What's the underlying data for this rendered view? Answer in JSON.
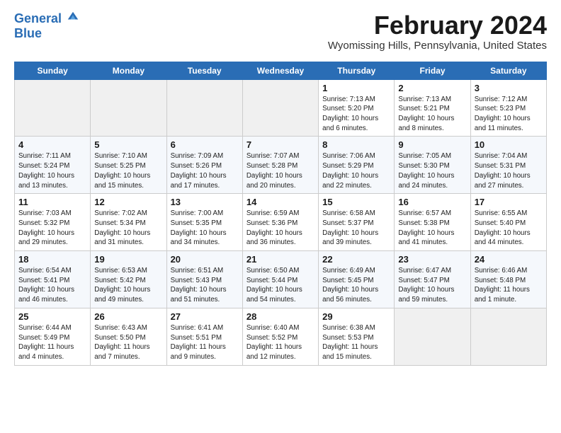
{
  "app": {
    "logo_line1": "General",
    "logo_line2": "Blue"
  },
  "header": {
    "month_year": "February 2024",
    "location": "Wyomissing Hills, Pennsylvania, United States"
  },
  "weekdays": [
    "Sunday",
    "Monday",
    "Tuesday",
    "Wednesday",
    "Thursday",
    "Friday",
    "Saturday"
  ],
  "weeks": [
    [
      {
        "day": "",
        "info": ""
      },
      {
        "day": "",
        "info": ""
      },
      {
        "day": "",
        "info": ""
      },
      {
        "day": "",
        "info": ""
      },
      {
        "day": "1",
        "info": "Sunrise: 7:13 AM\nSunset: 5:20 PM\nDaylight: 10 hours\nand 6 minutes."
      },
      {
        "day": "2",
        "info": "Sunrise: 7:13 AM\nSunset: 5:21 PM\nDaylight: 10 hours\nand 8 minutes."
      },
      {
        "day": "3",
        "info": "Sunrise: 7:12 AM\nSunset: 5:23 PM\nDaylight: 10 hours\nand 11 minutes."
      }
    ],
    [
      {
        "day": "4",
        "info": "Sunrise: 7:11 AM\nSunset: 5:24 PM\nDaylight: 10 hours\nand 13 minutes."
      },
      {
        "day": "5",
        "info": "Sunrise: 7:10 AM\nSunset: 5:25 PM\nDaylight: 10 hours\nand 15 minutes."
      },
      {
        "day": "6",
        "info": "Sunrise: 7:09 AM\nSunset: 5:26 PM\nDaylight: 10 hours\nand 17 minutes."
      },
      {
        "day": "7",
        "info": "Sunrise: 7:07 AM\nSunset: 5:28 PM\nDaylight: 10 hours\nand 20 minutes."
      },
      {
        "day": "8",
        "info": "Sunrise: 7:06 AM\nSunset: 5:29 PM\nDaylight: 10 hours\nand 22 minutes."
      },
      {
        "day": "9",
        "info": "Sunrise: 7:05 AM\nSunset: 5:30 PM\nDaylight: 10 hours\nand 24 minutes."
      },
      {
        "day": "10",
        "info": "Sunrise: 7:04 AM\nSunset: 5:31 PM\nDaylight: 10 hours\nand 27 minutes."
      }
    ],
    [
      {
        "day": "11",
        "info": "Sunrise: 7:03 AM\nSunset: 5:32 PM\nDaylight: 10 hours\nand 29 minutes."
      },
      {
        "day": "12",
        "info": "Sunrise: 7:02 AM\nSunset: 5:34 PM\nDaylight: 10 hours\nand 31 minutes."
      },
      {
        "day": "13",
        "info": "Sunrise: 7:00 AM\nSunset: 5:35 PM\nDaylight: 10 hours\nand 34 minutes."
      },
      {
        "day": "14",
        "info": "Sunrise: 6:59 AM\nSunset: 5:36 PM\nDaylight: 10 hours\nand 36 minutes."
      },
      {
        "day": "15",
        "info": "Sunrise: 6:58 AM\nSunset: 5:37 PM\nDaylight: 10 hours\nand 39 minutes."
      },
      {
        "day": "16",
        "info": "Sunrise: 6:57 AM\nSunset: 5:38 PM\nDaylight: 10 hours\nand 41 minutes."
      },
      {
        "day": "17",
        "info": "Sunrise: 6:55 AM\nSunset: 5:40 PM\nDaylight: 10 hours\nand 44 minutes."
      }
    ],
    [
      {
        "day": "18",
        "info": "Sunrise: 6:54 AM\nSunset: 5:41 PM\nDaylight: 10 hours\nand 46 minutes."
      },
      {
        "day": "19",
        "info": "Sunrise: 6:53 AM\nSunset: 5:42 PM\nDaylight: 10 hours\nand 49 minutes."
      },
      {
        "day": "20",
        "info": "Sunrise: 6:51 AM\nSunset: 5:43 PM\nDaylight: 10 hours\nand 51 minutes."
      },
      {
        "day": "21",
        "info": "Sunrise: 6:50 AM\nSunset: 5:44 PM\nDaylight: 10 hours\nand 54 minutes."
      },
      {
        "day": "22",
        "info": "Sunrise: 6:49 AM\nSunset: 5:45 PM\nDaylight: 10 hours\nand 56 minutes."
      },
      {
        "day": "23",
        "info": "Sunrise: 6:47 AM\nSunset: 5:47 PM\nDaylight: 10 hours\nand 59 minutes."
      },
      {
        "day": "24",
        "info": "Sunrise: 6:46 AM\nSunset: 5:48 PM\nDaylight: 11 hours\nand 1 minute."
      }
    ],
    [
      {
        "day": "25",
        "info": "Sunrise: 6:44 AM\nSunset: 5:49 PM\nDaylight: 11 hours\nand 4 minutes."
      },
      {
        "day": "26",
        "info": "Sunrise: 6:43 AM\nSunset: 5:50 PM\nDaylight: 11 hours\nand 7 minutes."
      },
      {
        "day": "27",
        "info": "Sunrise: 6:41 AM\nSunset: 5:51 PM\nDaylight: 11 hours\nand 9 minutes."
      },
      {
        "day": "28",
        "info": "Sunrise: 6:40 AM\nSunset: 5:52 PM\nDaylight: 11 hours\nand 12 minutes."
      },
      {
        "day": "29",
        "info": "Sunrise: 6:38 AM\nSunset: 5:53 PM\nDaylight: 11 hours\nand 15 minutes."
      },
      {
        "day": "",
        "info": ""
      },
      {
        "day": "",
        "info": ""
      }
    ]
  ]
}
